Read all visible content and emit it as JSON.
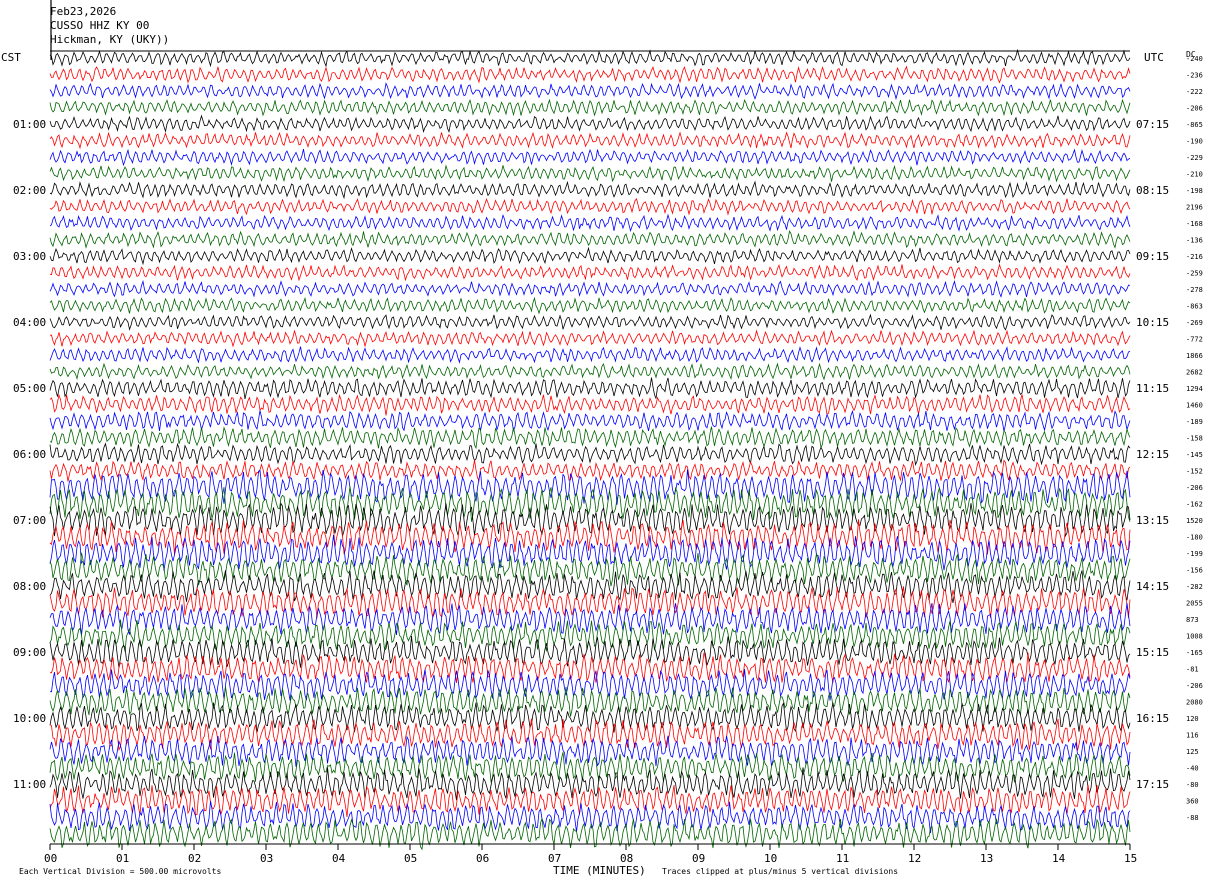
{
  "header": {
    "date": "Feb23,2026",
    "station": "CUSSO HHZ KY 00",
    "location": "Hickman, KY (UKY))"
  },
  "footer": {
    "division_note": "Each Vertical Division =  500.00 microvolts",
    "clip_note": "Traces clipped at plus/minus 5 vertical divisions"
  },
  "colors": {
    "trace_cycle": [
      "#000000",
      "#ff0000",
      "#0000ff",
      "#006400"
    ]
  },
  "chart_data": {
    "type": "line",
    "title": "",
    "xlabel": "TIME (MINUTES)",
    "ylabel_left": "CST",
    "ylabel_right": "UTC",
    "dc_label": "DC",
    "xlim": [
      0,
      15
    ],
    "x_ticks": [
      "00",
      "01",
      "02",
      "03",
      "04",
      "05",
      "06",
      "07",
      "08",
      "09",
      "10",
      "11",
      "12",
      "13",
      "14",
      "15"
    ],
    "num_traces": 48,
    "trace_minutes": 15,
    "left_time_labels": [
      "01:00",
      "02:00",
      "03:00",
      "04:00",
      "05:00",
      "06:00",
      "07:00",
      "08:00",
      "09:00",
      "10:00",
      "11:00"
    ],
    "right_time_labels": [
      "07:15",
      "08:15",
      "09:15",
      "10:15",
      "11:15",
      "12:15",
      "13:15",
      "14:15",
      "15:15",
      "16:15",
      "17:15"
    ],
    "dc_offsets": [
      "-240",
      "-236",
      "-222",
      "-206",
      "-865",
      "-190",
      "-229",
      "-210",
      "-198",
      "2196",
      "-168",
      "-136",
      "-216",
      "-259",
      "-278",
      "-863",
      "-269",
      "-772",
      "1866",
      "2682",
      "1294",
      "1460",
      "-189",
      "-158",
      "-145",
      "-152",
      "-206",
      "-162",
      "1520",
      "-180",
      "-199",
      "-156",
      "-282",
      "2055",
      "873",
      "1008",
      "-165",
      "-81",
      "-206",
      "2080",
      "120",
      "116",
      "125",
      "-40",
      "-80",
      "360",
      "-88"
    ],
    "grid": false
  }
}
